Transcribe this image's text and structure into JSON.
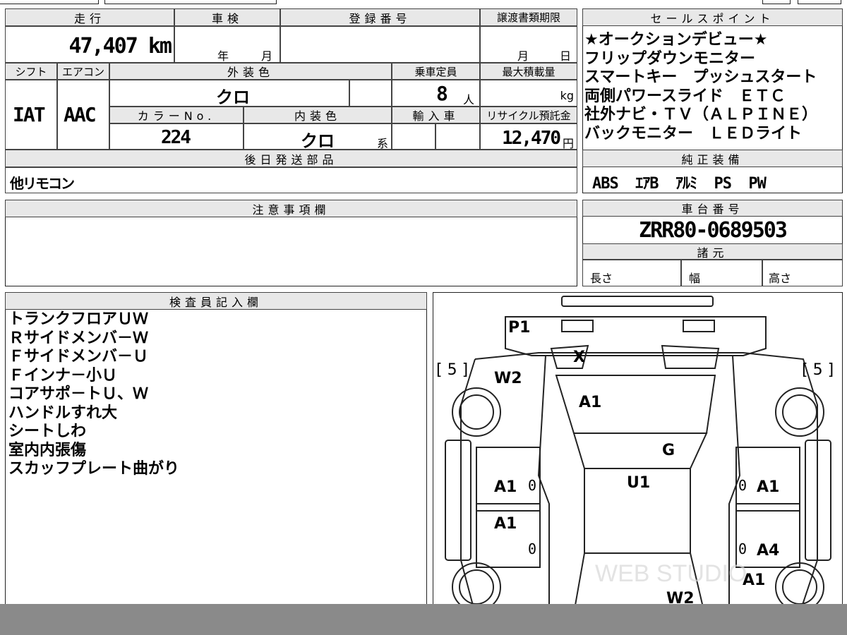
{
  "mileage": {
    "header": "走行",
    "value": "47,407 km"
  },
  "shaken": {
    "header": "車検",
    "year_label": "年",
    "month_label": "月"
  },
  "registration": {
    "header": "登録番号",
    "value": ""
  },
  "transfer": {
    "header": "譲渡書類期限",
    "month_label": "月",
    "day_label": "日"
  },
  "shift": {
    "header": "シフト",
    "value": "IAT"
  },
  "aircon": {
    "header": "エアコン",
    "value": "AAC"
  },
  "exterior_color": {
    "header": "外装色",
    "value": "クロ"
  },
  "capacity": {
    "header": "乗車定員",
    "value": "8",
    "unit": "人"
  },
  "max_load": {
    "header": "最大積載量",
    "unit": "kg"
  },
  "color_no": {
    "header": "カラーNo.",
    "value": "224"
  },
  "interior_color": {
    "header": "内装色",
    "value": "クロ",
    "suffix": "系"
  },
  "import": {
    "header": "輸入車"
  },
  "recycle": {
    "header": "リサイクル預託金",
    "value": "12,470",
    "unit": "円"
  },
  "shipping": {
    "header": "後日発送部品",
    "value": "他リモコン"
  },
  "sales_points": {
    "header": "セールスポイント",
    "lines": [
      "★オークションデビュー★",
      "フリップダウンモニター",
      "スマートキー　プッシュスタート",
      "両側パワースライド　ＥＴＣ",
      "社外ナビ・ＴＶ（ＡＬＰＩＮＥ）",
      "バックモニター　ＬＥＤライト"
    ]
  },
  "equipment": {
    "header": "純正装備",
    "value": "ABS  ｴｱB  ｱﾙﾐ  PS  PW"
  },
  "notes": {
    "header": "注意事項欄"
  },
  "chassis": {
    "header": "車台番号",
    "value": "ZRR80-0689503"
  },
  "specs": {
    "header": "諸元",
    "length": "長さ",
    "width": "幅",
    "height": "高さ"
  },
  "inspector": {
    "header": "検査員記入欄",
    "lines": [
      "トランクフロアＵＷ",
      "Ｒサイドメンバ－Ｗ",
      "Ｆサイドメンバ－Ｕ",
      "Ｆインナ－小Ｕ",
      "コアサポ－トＵ、Ｗ",
      "ハンドルすれ大",
      "シートしわ",
      "室内内張傷",
      "スカッフプレート曲がり"
    ]
  },
  "diagram": {
    "left_grade": "[ 5 ]",
    "right_grade": "[ 5 ]",
    "marks": {
      "p1": "P1",
      "x": "X",
      "w2_top": "W2",
      "a1_hood": "A1",
      "g": "G",
      "u1": "U1",
      "a1_fl": "A1",
      "a1_fr": "A1",
      "a1_rl": "A1",
      "a4_rr": "A4",
      "a1_rr2": "A1",
      "w2_bottom": "W2"
    },
    "zeros": [
      "0",
      "0",
      "0",
      "0"
    ],
    "watermark": "WEB STUDIO"
  }
}
